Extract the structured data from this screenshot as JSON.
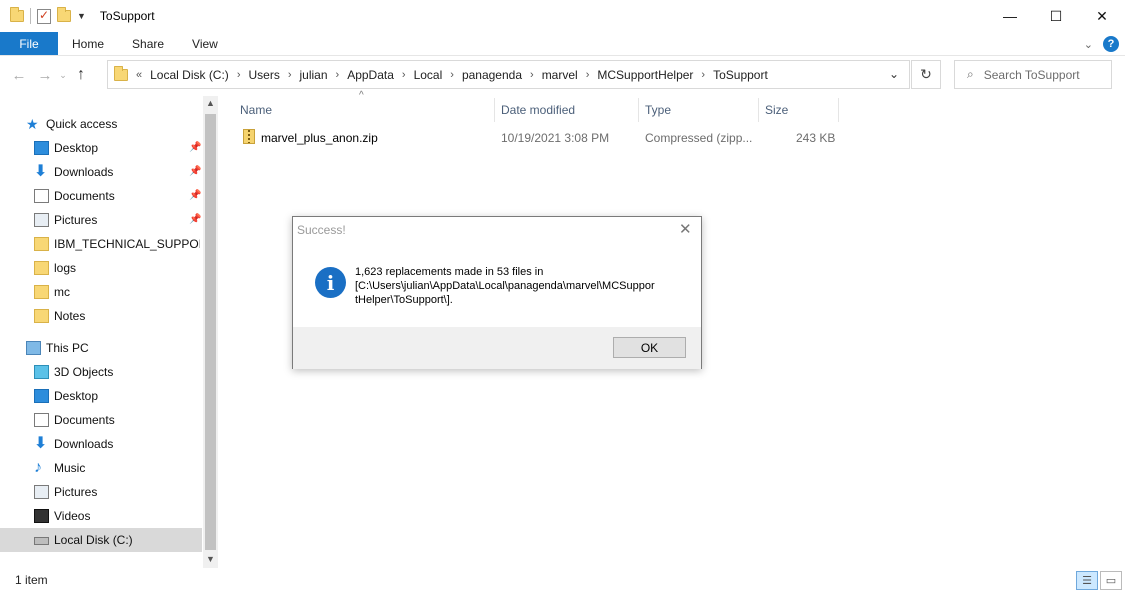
{
  "window": {
    "title": "ToSupport",
    "minimize": "—",
    "maximize": "☐",
    "close": "✕"
  },
  "ribbon": {
    "tabs": [
      "File",
      "Home",
      "Share",
      "View"
    ],
    "help": "?"
  },
  "address": {
    "leading": "«",
    "crumbs": [
      "Local Disk (C:)",
      "Users",
      "julian",
      "AppData",
      "Local",
      "panagenda",
      "marvel",
      "MCSupportHelper",
      "ToSupport"
    ],
    "search_placeholder": "Search ToSupport"
  },
  "navpane": {
    "quick_access": "Quick access",
    "quick_items": [
      {
        "label": "Desktop",
        "icon": "desktop-icon",
        "pinned": true
      },
      {
        "label": "Downloads",
        "icon": "downloads-icon",
        "pinned": true
      },
      {
        "label": "Documents",
        "icon": "documents-icon",
        "pinned": true
      },
      {
        "label": "Pictures",
        "icon": "pictures-icon",
        "pinned": true
      },
      {
        "label": "IBM_TECHNICAL_SUPPORT",
        "icon": "folder-icon",
        "pinned": false
      },
      {
        "label": "logs",
        "icon": "folder-icon",
        "pinned": false
      },
      {
        "label": "mc",
        "icon": "folder-icon",
        "pinned": false
      },
      {
        "label": "Notes",
        "icon": "folder-icon",
        "pinned": false
      }
    ],
    "this_pc": "This PC",
    "pc_items": [
      {
        "label": "3D Objects",
        "icon": "3d-objects-icon"
      },
      {
        "label": "Desktop",
        "icon": "desktop-icon"
      },
      {
        "label": "Documents",
        "icon": "documents-icon"
      },
      {
        "label": "Downloads",
        "icon": "downloads-icon"
      },
      {
        "label": "Music",
        "icon": "music-icon"
      },
      {
        "label": "Pictures",
        "icon": "pictures-icon"
      },
      {
        "label": "Videos",
        "icon": "videos-icon"
      },
      {
        "label": "Local Disk (C:)",
        "icon": "disk-icon",
        "selected": true
      }
    ]
  },
  "filelist": {
    "columns": {
      "name": "Name",
      "date": "Date modified",
      "type": "Type",
      "size": "Size"
    },
    "rows": [
      {
        "name": "marvel_plus_anon.zip",
        "date": "10/19/2021 3:08 PM",
        "type": "Compressed (zipp...",
        "size": "243 KB"
      }
    ]
  },
  "status": {
    "count": "1 item"
  },
  "dialog": {
    "title": "Success!",
    "message_lines": [
      "1,623 replacements made in 53 files in",
      "[C:\\Users\\julian\\AppData\\Local\\panagenda\\marvel\\MCSuppor",
      "tHelper\\ToSupport\\]."
    ],
    "ok_label": "OK",
    "close": "✕",
    "info_glyph": "i"
  }
}
